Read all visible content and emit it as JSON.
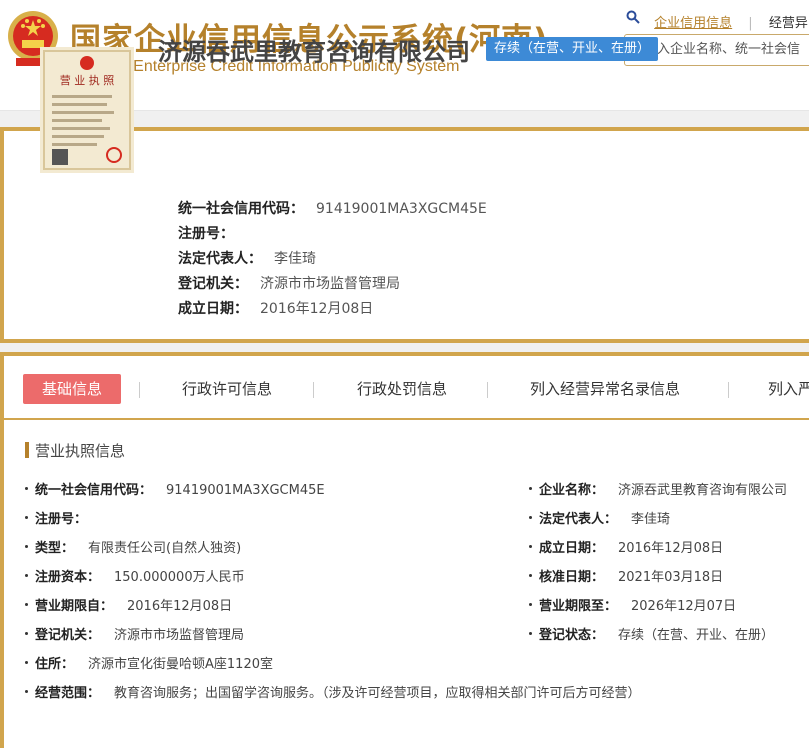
{
  "header": {
    "title": "国家企业信用信息公示系统(河南)",
    "subtitle": "National Enterprise Credit Information Publicity System",
    "link_credit": "企业信用信息",
    "link_abnormal": "经营异",
    "search_placeholder": "请输入企业名称、统一社会信",
    "icon_emblem": "national-emblem-icon",
    "icon_search": "search-icon"
  },
  "company": {
    "name": "济源吞武里教育咨询有限公司",
    "status": "存续（在营、开业、在册）",
    "fields": [
      {
        "label": "统一社会信用代码：",
        "value": "91419001MA3XGCM45E"
      },
      {
        "label": "注册号：",
        "value": ""
      },
      {
        "label": "法定代表人：",
        "value": "李佳琦"
      },
      {
        "label": "登记机关：",
        "value": "济源市市场监督管理局"
      },
      {
        "label": "成立日期：",
        "value": "2016年12月08日"
      }
    ]
  },
  "tabs": [
    "基础信息",
    "行政许可信息",
    "行政处罚信息",
    "列入经营异常名录信息",
    "列入严"
  ],
  "section": {
    "title": "营业执照信息",
    "left": [
      {
        "label": "统一社会信用代码：",
        "value": "91419001MA3XGCM45E"
      },
      {
        "label": "注册号：",
        "value": ""
      },
      {
        "label": "类型：",
        "value": "有限责任公司(自然人独资)"
      },
      {
        "label": "注册资本：",
        "value": "150.000000万人民币"
      },
      {
        "label": "营业期限自：",
        "value": "2016年12月08日"
      },
      {
        "label": "登记机关：",
        "value": "济源市市场监督管理局"
      },
      {
        "label": "住所：",
        "value": "济源市宣化街曼哈顿A座1120室"
      },
      {
        "label": "经营范围：",
        "value": "教育咨询服务；出国留学咨询服务。（涉及许可经营项目，应取得相关部门许可后方可经营）"
      }
    ],
    "right": [
      {
        "label": "企业名称：",
        "value": "济源吞武里教育咨询有限公司"
      },
      {
        "label": "法定代表人：",
        "value": "李佳琦"
      },
      {
        "label": "成立日期：",
        "value": "2016年12月08日"
      },
      {
        "label": "核准日期：",
        "value": "2021年03月18日"
      },
      {
        "label": "营业期限至：",
        "value": "2026年12月07日"
      },
      {
        "label": "登记状态：",
        "value": "存续（在营、开业、在册）"
      }
    ]
  }
}
